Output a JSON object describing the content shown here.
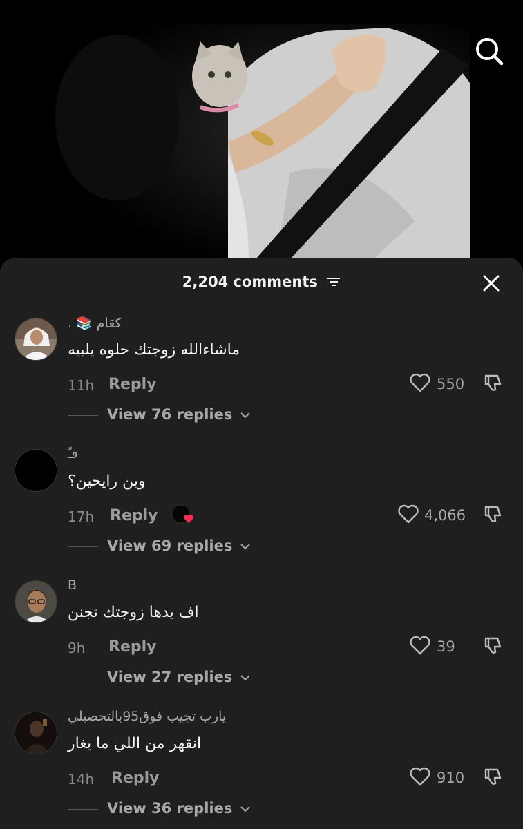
{
  "header": {
    "comment_count": "2,204 comments"
  },
  "icons": {
    "search": "search-icon",
    "filter": "filter-icon",
    "close": "close-icon",
    "like": "heart-outline-icon",
    "dislike": "thumbs-down-icon",
    "expand": "chevron-down-icon"
  },
  "colors": {
    "sheet_bg": "#1f1f1f",
    "text_primary": "#f5f5f5",
    "text_secondary": "#a8a8a8",
    "heart_red": "#fe2c55"
  },
  "comments": [
    {
      "username": "كعَام 📚 .",
      "text": "ماشاءالله زوجتك حلوه يلبيه",
      "time": "11h",
      "reply_label": "Reply",
      "likes": "550",
      "view_replies": "View 76 replies",
      "liked_by_creator": false
    },
    {
      "username": "فـّ",
      "text": "وين رايحين؟",
      "time": "17h",
      "reply_label": "Reply",
      "likes": "4,066",
      "view_replies": "View 69 replies",
      "liked_by_creator": true
    },
    {
      "username": "B",
      "text": "اف يدها زوجتك تجنن",
      "time": "9h",
      "reply_label": "Reply",
      "likes": "39",
      "view_replies": "View 27 replies",
      "liked_by_creator": false
    },
    {
      "username": "يارب تجيب فوق95بالتحصيلي",
      "text": "انقهر من اللي ما يغار",
      "time": "14h",
      "reply_label": "Reply",
      "likes": "910",
      "view_replies": "View 36 replies",
      "liked_by_creator": false
    }
  ]
}
